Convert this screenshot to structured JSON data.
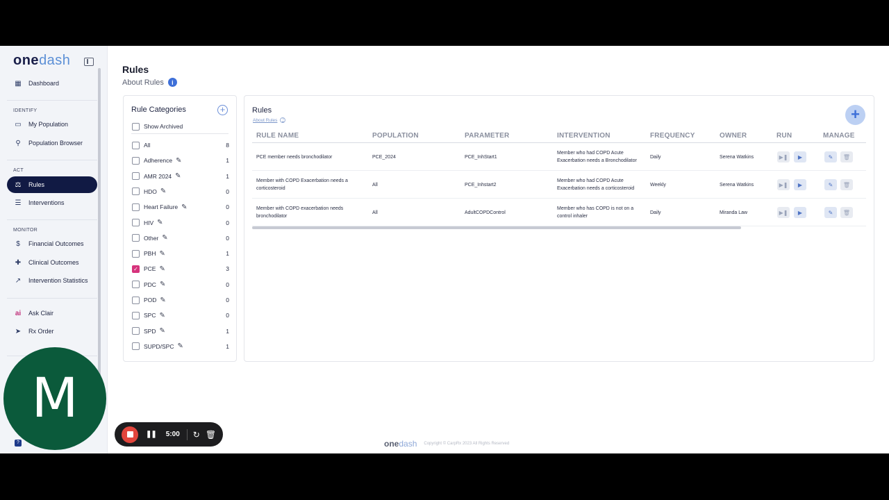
{
  "app": {
    "logo_one": "one",
    "logo_dash": "dash"
  },
  "sidebar": {
    "items": [
      {
        "label": "Dashboard",
        "icon": "grid-icon"
      },
      {
        "label": "My Population",
        "icon": "id-card-icon"
      },
      {
        "label": "Population Browser",
        "icon": "people-search-icon"
      },
      {
        "label": "Rules",
        "icon": "rules-icon",
        "active": true
      },
      {
        "label": "Interventions",
        "icon": "list-icon"
      },
      {
        "label": "Financial Outcomes",
        "icon": "money-chart-icon"
      },
      {
        "label": "Clinical Outcomes",
        "icon": "clinical-icon"
      },
      {
        "label": "Intervention Statistics",
        "icon": "line-chart-icon"
      },
      {
        "label": "Ask Clair",
        "icon": "ai-icon"
      },
      {
        "label": "Rx Order",
        "icon": "rx-order-icon"
      }
    ],
    "sections": {
      "identify": "IDENTIFY",
      "act": "ACT",
      "monitor": "MONITOR"
    }
  },
  "header": {
    "title": "Rules",
    "about": "About Rules"
  },
  "categories": {
    "title": "Rule Categories",
    "show_archived": "Show Archived",
    "items": [
      {
        "label": "All",
        "count": "8",
        "edit": false,
        "checked": false
      },
      {
        "label": "Adherence",
        "count": "1",
        "edit": true,
        "checked": false
      },
      {
        "label": "AMR 2024",
        "count": "1",
        "edit": true,
        "checked": false
      },
      {
        "label": "HDO",
        "count": "0",
        "edit": true,
        "checked": false
      },
      {
        "label": "Heart Failure",
        "count": "0",
        "edit": true,
        "checked": false
      },
      {
        "label": "HIV",
        "count": "0",
        "edit": true,
        "checked": false
      },
      {
        "label": "Other",
        "count": "0",
        "edit": true,
        "checked": false
      },
      {
        "label": "PBH",
        "count": "1",
        "edit": true,
        "checked": false
      },
      {
        "label": "PCE",
        "count": "3",
        "edit": true,
        "checked": true
      },
      {
        "label": "PDC",
        "count": "0",
        "edit": true,
        "checked": false
      },
      {
        "label": "POD",
        "count": "0",
        "edit": true,
        "checked": false
      },
      {
        "label": "SPC",
        "count": "0",
        "edit": true,
        "checked": false
      },
      {
        "label": "SPD",
        "count": "1",
        "edit": true,
        "checked": false
      },
      {
        "label": "SUPD/SPC",
        "count": "1",
        "edit": true,
        "checked": false
      }
    ]
  },
  "rules": {
    "title": "Rules",
    "about": "About Rules",
    "columns": [
      "RULE NAME",
      "POPULATION",
      "PARAMETER",
      "INTERVENTION",
      "FREQUENCY",
      "OWNER",
      "RUN",
      "MANAGE"
    ],
    "rows": [
      {
        "name": "PCE member needs bronchodilator",
        "population": "PCE_2024",
        "parameter": "PCE_InhStart1",
        "intervention": "Member who had COPD Acute Exacerbation needs a Bronchodilator",
        "frequency": "Daily",
        "owner": "Serena Watkins"
      },
      {
        "name": "Member with COPD Exacerbation needs a corticosteroid",
        "population": "All",
        "parameter": "PCE_Inhstart2",
        "intervention": "Member who had COPD Acute Exacerbation needs a corticosteroid",
        "frequency": "Weekly",
        "owner": "Serena Watkins"
      },
      {
        "name": "Member with COPD exacerbation needs bronchodilator",
        "population": "All",
        "parameter": "AdultCOPDControl",
        "intervention": "Member who has COPD is not on a control inhaler",
        "frequency": "Daily",
        "owner": "Miranda Law"
      }
    ]
  },
  "footer": {
    "logo_one": "one",
    "logo_dash": "dash",
    "copyright": "Copyright © CarpRx 2023 All Rights Reserved"
  },
  "overlay": {
    "avatar_letter": "M",
    "timer": "5:00"
  },
  "colors": {
    "active_nav": "#111a44",
    "checkbox_checked": "#d6337c",
    "accent_blue": "#3d6fd8",
    "avatar_bg": "#0b5a3b",
    "record_red": "#e2453c"
  }
}
